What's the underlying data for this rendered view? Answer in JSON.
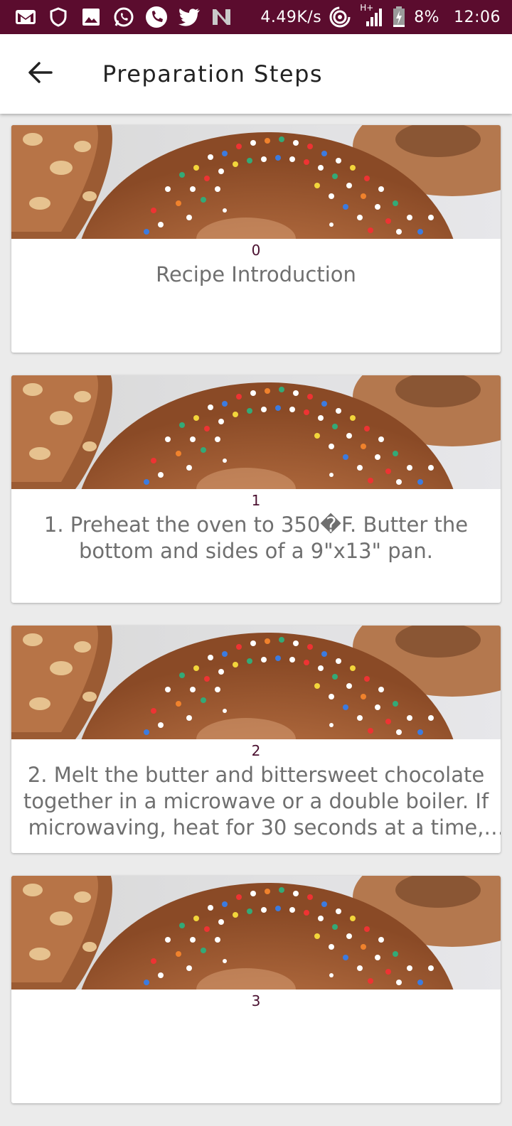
{
  "status_bar": {
    "network_speed": "4.49K/s",
    "signal_label": "H+",
    "battery": "8%",
    "time": "12:06",
    "bg_color": "#5b0c2e"
  },
  "app_bar": {
    "title": "Preparation Steps",
    "back_icon": "arrow-back-icon"
  },
  "steps": [
    {
      "index": "0",
      "text": "Recipe Introduction"
    },
    {
      "index": "1",
      "text": "1. Preheat the oven to 350�F. Butter the bottom and sides of a 9\"x13\" pan."
    },
    {
      "index": "2",
      "text": "2. Melt the butter and bittersweet chocolate together in a microwave or a double boiler. If microwaving, heat for 30 seconds at a time, r..."
    },
    {
      "index": "3",
      "text": ""
    }
  ]
}
